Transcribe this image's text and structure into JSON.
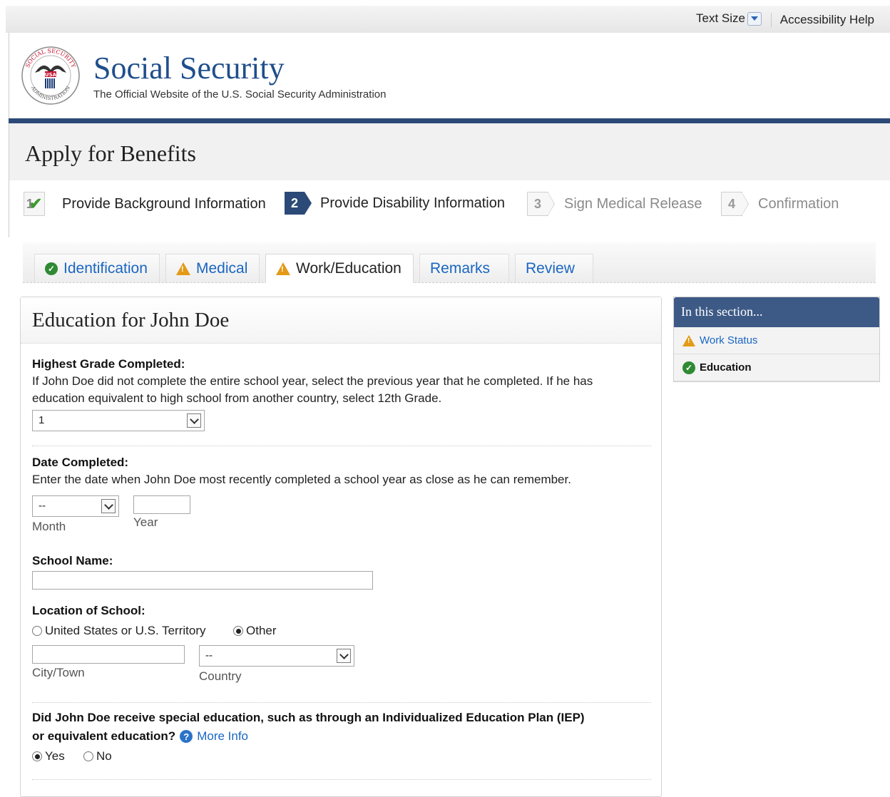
{
  "utility": {
    "text_size_label": "Text Size",
    "accessibility_help": "Accessibility Help"
  },
  "header": {
    "seal_text_top": "SOCIAL SECURITY",
    "seal_text_bottom": "ADMINISTRATION",
    "seal_usa": "USA",
    "title": "Social Security",
    "subtitle": "The Official Website of the U.S. Social Security Administration"
  },
  "page": {
    "title": "Apply for Benefits"
  },
  "steps": [
    {
      "num": "1",
      "label": "Provide Background Information",
      "state": "done"
    },
    {
      "num": "2",
      "label": "Provide Disability Information",
      "state": "active"
    },
    {
      "num": "3",
      "label": "Sign Medical Release",
      "state": "todo"
    },
    {
      "num": "4",
      "label": "Confirmation",
      "state": "todo"
    }
  ],
  "tabs": [
    {
      "label": "Identification",
      "status": "ok"
    },
    {
      "label": "Medical",
      "status": "warning"
    },
    {
      "label": "Work/Education",
      "status": "warning",
      "active": true
    },
    {
      "label": "Remarks"
    },
    {
      "label": "Review"
    }
  ],
  "main": {
    "title": "Education for John Doe",
    "grade": {
      "label": "Highest Grade Completed:",
      "help": "If John Doe did not complete the entire school year, select the previous year that he completed. If he has education equivalent to high school from another country, select 12th Grade.",
      "value": "1"
    },
    "date": {
      "label": "Date Completed:",
      "help": "Enter the date when John Doe most recently completed a school year as close as he can remember.",
      "month_value": "--",
      "month_label": "Month",
      "year_value": "",
      "year_label": "Year"
    },
    "school": {
      "label": "School Name:",
      "value": ""
    },
    "location": {
      "label": "Location of School:",
      "option_us": "United States or U.S. Territory",
      "option_other": "Other",
      "selected": "Other",
      "city_value": "",
      "city_label": "City/Town",
      "country_value": "--",
      "country_label": "Country"
    },
    "special_ed": {
      "question_line1": "Did John Doe receive special education, such as through an Individualized Education Plan (IEP)",
      "question_line2": "or equivalent education?",
      "more_info": "More Info",
      "yes": "Yes",
      "no": "No",
      "selected": "Yes"
    }
  },
  "sidebar": {
    "heading": "In this section...",
    "items": [
      {
        "label": "Work Status",
        "status": "warning"
      },
      {
        "label": "Education",
        "status": "ok"
      }
    ]
  },
  "colors": {
    "brand_navy": "#2c4a77",
    "link_blue": "#1a66c2",
    "ok_green": "#2f8a33",
    "warning_orange": "#e39a16"
  }
}
